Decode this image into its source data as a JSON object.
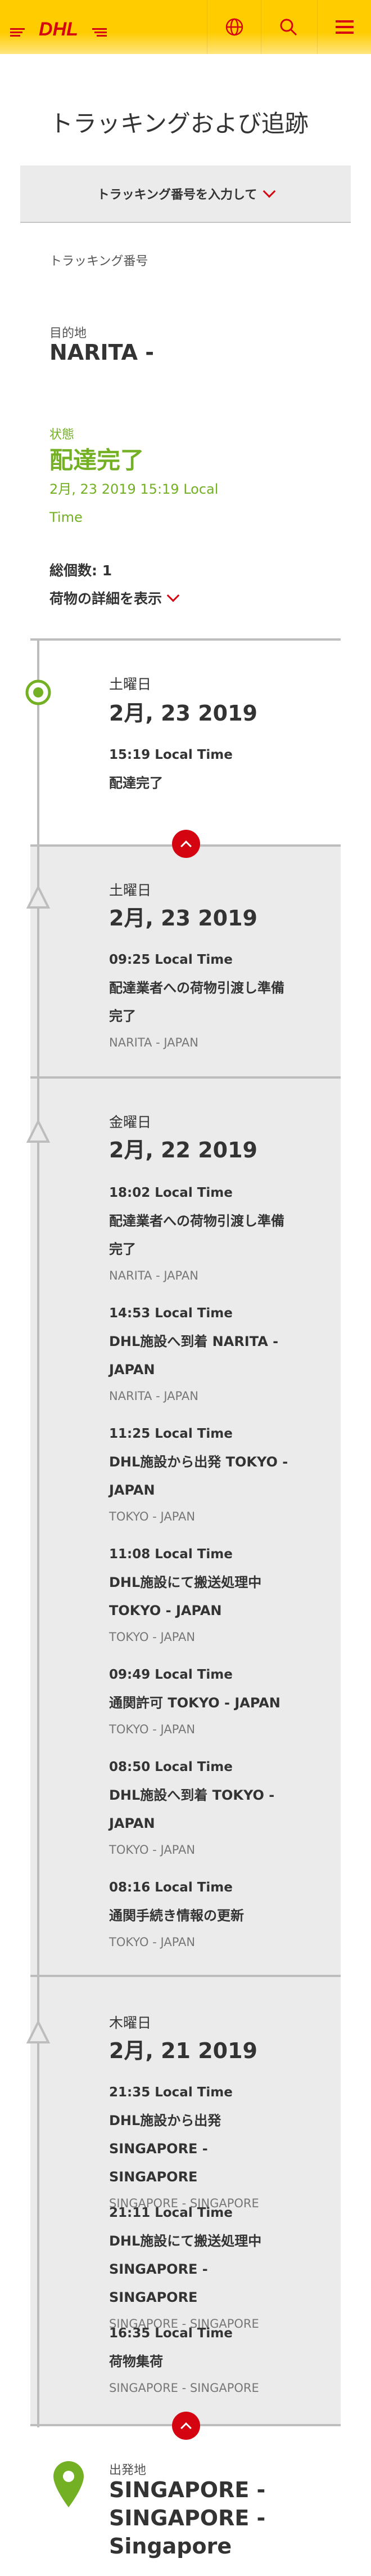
{
  "header": {
    "logo_text": "DHL",
    "brand_yellow": "#ffcc00",
    "brand_red": "#d40511",
    "icons": [
      "globe-icon",
      "search-icon",
      "menu-icon"
    ]
  },
  "page_title": "トラッキングおよび追跡",
  "track_input": {
    "label": "トラッキング番号を入力して"
  },
  "tracking_number_label": "トラッキング番号",
  "destination": {
    "label": "目的地",
    "value": "NARITA -"
  },
  "status": {
    "label": "状態",
    "value": "配達完了",
    "time": "2月, 23 2019 15:19 Local Time",
    "color": "#73b023"
  },
  "pieces_total": "総個数: 1",
  "show_details": "荷物の詳細を表示",
  "timeline": {
    "day1": {
      "day": "土曜日",
      "date": "2月, 23 2019",
      "e1": {
        "time": "15:19 Local Time",
        "desc": "配達完了"
      }
    },
    "day2": {
      "day": "土曜日",
      "date": "2月, 23 2019",
      "e1": {
        "time": "09:25 Local Time",
        "desc": "配達業者への荷物引渡し準備完了",
        "loc": "NARITA - JAPAN"
      }
    },
    "day3": {
      "day": "金曜日",
      "date": "2月, 22 2019",
      "e1": {
        "time": "18:02 Local Time",
        "desc": "配達業者への荷物引渡し準備完了",
        "loc": "NARITA - JAPAN"
      },
      "e2": {
        "time": "14:53 Local Time",
        "desc": "DHL施設へ到着 NARITA - JAPAN",
        "loc": "NARITA - JAPAN"
      },
      "e3": {
        "time": "11:25 Local Time",
        "desc": "DHL施設から出発 TOKYO - JAPAN",
        "loc": "TOKYO - JAPAN"
      },
      "e4": {
        "time": "11:08 Local Time",
        "desc": "DHL施設にて搬送処理中 TOKYO - JAPAN",
        "loc": "TOKYO - JAPAN"
      },
      "e5": {
        "time": "09:49 Local Time",
        "desc": "通関許可 TOKYO - JAPAN",
        "loc": "TOKYO - JAPAN"
      },
      "e6": {
        "time": "08:50 Local Time",
        "desc": "DHL施設へ到着 TOKYO - JAPAN",
        "loc": "TOKYO - JAPAN"
      },
      "e7": {
        "time": "08:16 Local Time",
        "desc": "通関手続き情報の更新",
        "loc": "TOKYO - JAPAN"
      }
    },
    "day4": {
      "day": "木曜日",
      "date": "2月, 21 2019",
      "e1": {
        "time": "21:35 Local Time",
        "desc": "DHL施設から出発 SINGAPORE - SINGAPORE",
        "loc": "SINGAPORE - SINGAPORE"
      },
      "e2": {
        "time": "21:11 Local Time",
        "desc": "DHL施設にて搬送処理中 SINGAPORE - SINGAPORE",
        "loc": "SINGAPORE - SINGAPORE"
      },
      "e3": {
        "time": "16:35 Local Time",
        "desc": "荷物集荷",
        "loc": "SINGAPORE - SINGAPORE"
      }
    }
  },
  "origin": {
    "label": "出発地",
    "value": "SINGAPORE - SINGAPORE - Singapore"
  }
}
